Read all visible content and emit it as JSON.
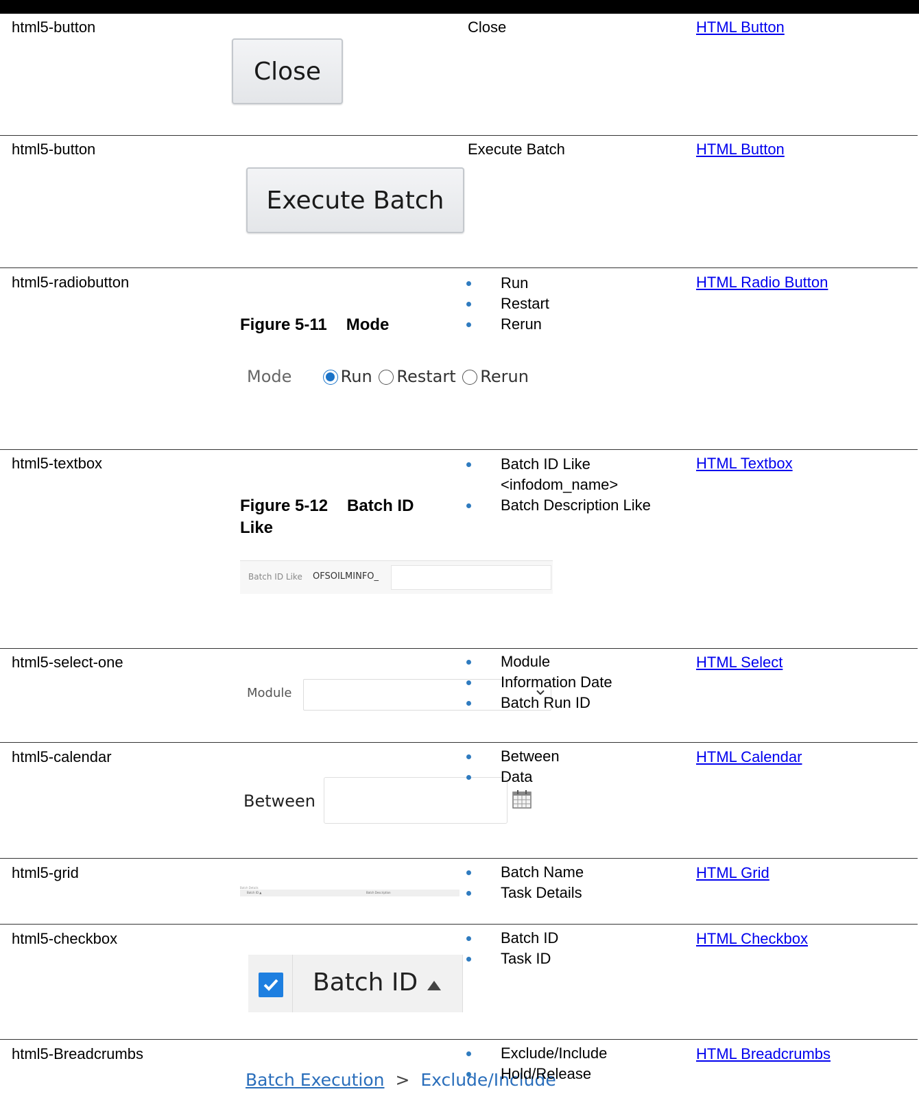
{
  "rows": [
    {
      "type": "html5-button",
      "image": {
        "label": "Close"
      },
      "values": [
        "Close"
      ],
      "link": "HTML Button"
    },
    {
      "type": "html5-button",
      "image": {
        "label": "Execute Batch"
      },
      "values": [
        "Execute Batch"
      ],
      "link": "HTML Button"
    },
    {
      "type": "html5-radiobutton",
      "figure": {
        "number": "Figure 5-11",
        "title": "Mode"
      },
      "image": {
        "label": "Mode",
        "options": [
          "Run",
          "Restart",
          "Rerun"
        ],
        "selected": "Run"
      },
      "values": [
        "Run",
        "Restart",
        "Rerun"
      ],
      "link": "HTML Radio Button"
    },
    {
      "type": "html5-textbox",
      "figure": {
        "number": "Figure 5-12",
        "title": "Batch ID Like"
      },
      "image": {
        "label": "Batch ID Like",
        "prefix": "OFSOILMINFO_"
      },
      "values": [
        "Batch ID Like <infodom_name>",
        "Batch Description Like"
      ],
      "link": "HTML Textbox"
    },
    {
      "type": "html5-select-one",
      "image": {
        "label": "Module"
      },
      "values": [
        "Module",
        "Information Date",
        "Batch Run ID"
      ],
      "link": "HTML Select"
    },
    {
      "type": "html5-calendar",
      "image": {
        "label": "Between"
      },
      "values": [
        "Between",
        "Data"
      ],
      "link": "HTML Calendar"
    },
    {
      "type": "html5-grid",
      "image": {
        "title": "Batch Details",
        "col1": "Batch ID ▲",
        "col2": "Batch Description"
      },
      "values": [
        "Batch Name",
        "Task Details"
      ],
      "link": "HTML Grid"
    },
    {
      "type": "html5-checkbox",
      "image": {
        "label": "Batch ID"
      },
      "values": [
        "Batch ID",
        "Task ID"
      ],
      "link": "HTML Checkbox"
    },
    {
      "type": "html5-Breadcrumbs",
      "image": {
        "crumb1": "Batch Execution",
        "separator": ">",
        "crumb2": "Exclude/Include"
      },
      "values": [
        "Exclude/Include",
        "Hold/Release"
      ],
      "link": "HTML Breadcrumbs"
    }
  ]
}
